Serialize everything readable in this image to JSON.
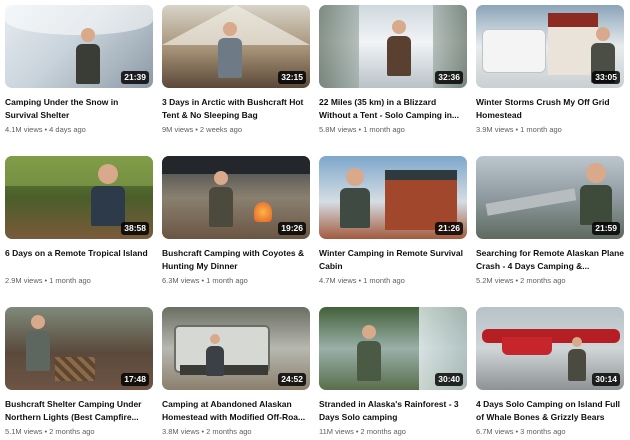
{
  "videos": [
    {
      "title": "Camping Under the Snow in Survival Shelter",
      "duration": "21:39",
      "views": "4.1M views",
      "age": "4 days ago"
    },
    {
      "title": "3 Days in Arctic with Bushcraft Hot Tent & No Sleeping Bag",
      "duration": "32:15",
      "views": "9M views",
      "age": "2 weeks ago"
    },
    {
      "title": "22 Miles (35 km) in a Blizzard Without a Tent - Solo Camping in...",
      "duration": "32:36",
      "views": "5.8M views",
      "age": "1 month ago"
    },
    {
      "title": "Winter Storms Crush My Off Grid Homestead",
      "duration": "33:05",
      "views": "3.9M views",
      "age": "1 month ago"
    },
    {
      "title": "6 Days on a Remote Tropical Island",
      "duration": "38:58",
      "views": "2.9M views",
      "age": "1 month ago"
    },
    {
      "title": "Bushcraft Camping with Coyotes & Hunting My Dinner",
      "duration": "19:26",
      "views": "6.3M views",
      "age": "1 month ago"
    },
    {
      "title": "Winter Camping in Remote Survival Cabin",
      "duration": "21:26",
      "views": "4.7M views",
      "age": "1 month ago"
    },
    {
      "title": "Searching for Remote Alaskan Plane Crash - 4 Days Camping &...",
      "duration": "21:59",
      "views": "5.2M views",
      "age": "2 months ago"
    },
    {
      "title": "Bushcraft Shelter Camping Under Northern Lights (Best Campfire...",
      "duration": "17:48",
      "views": "5.1M views",
      "age": "2 months ago"
    },
    {
      "title": "Camping at Abandoned Alaskan Homestead with Modified Off-Roa...",
      "duration": "24:52",
      "views": "3.8M views",
      "age": "2 months ago"
    },
    {
      "title": "Stranded in Alaska's Rainforest - 3 Days Solo camping",
      "duration": "30:40",
      "views": "11M views",
      "age": "2 months ago"
    },
    {
      "title": "4 Days Solo Camping on Island Full of Whale Bones & Grizzly Bears",
      "duration": "30:14",
      "views": "6.7M views",
      "age": "3 months ago"
    }
  ]
}
